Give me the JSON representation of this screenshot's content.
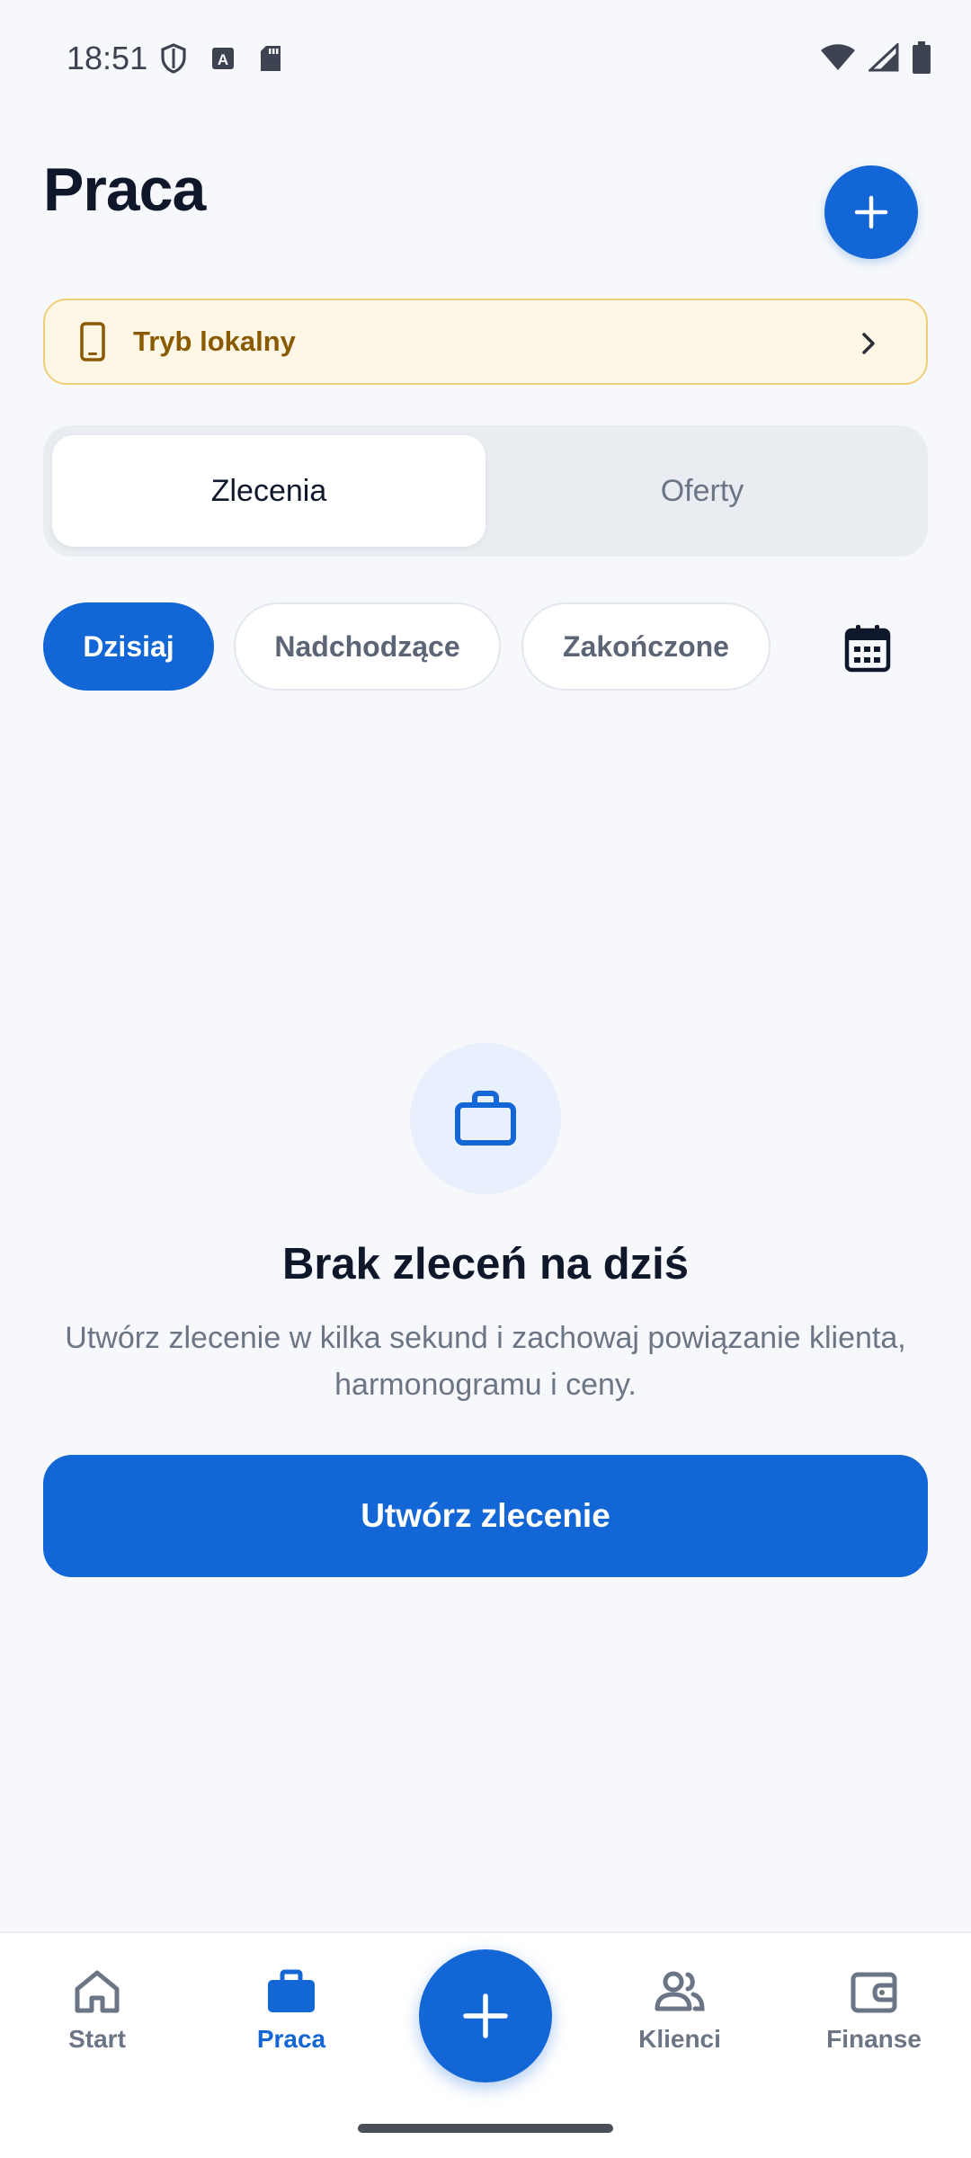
{
  "status_bar": {
    "time": "18:51"
  },
  "header": {
    "title": "Praca"
  },
  "local_mode": {
    "label": "Tryb lokalny"
  },
  "segments": {
    "active": "Zlecenia",
    "inactive": "Oferty"
  },
  "filters": {
    "today": "Dzisiaj",
    "upcoming": "Nadchodzące",
    "completed": "Zakończone"
  },
  "empty_state": {
    "title": "Brak zleceń na dziś",
    "description": "Utwórz zlecenie w kilka sekund i zachowaj powiązanie klienta, harmonogramu i ceny.",
    "button": "Utwórz zlecenie"
  },
  "nav": {
    "start": "Start",
    "praca": "Praca",
    "klienci": "Klienci",
    "finanse": "Finanse"
  },
  "colors": {
    "accent": "#1366d6",
    "banner_bg": "#fff7e6",
    "banner_text": "#8a5a00",
    "text_primary": "#0f172a",
    "text_secondary": "#6b7585"
  }
}
